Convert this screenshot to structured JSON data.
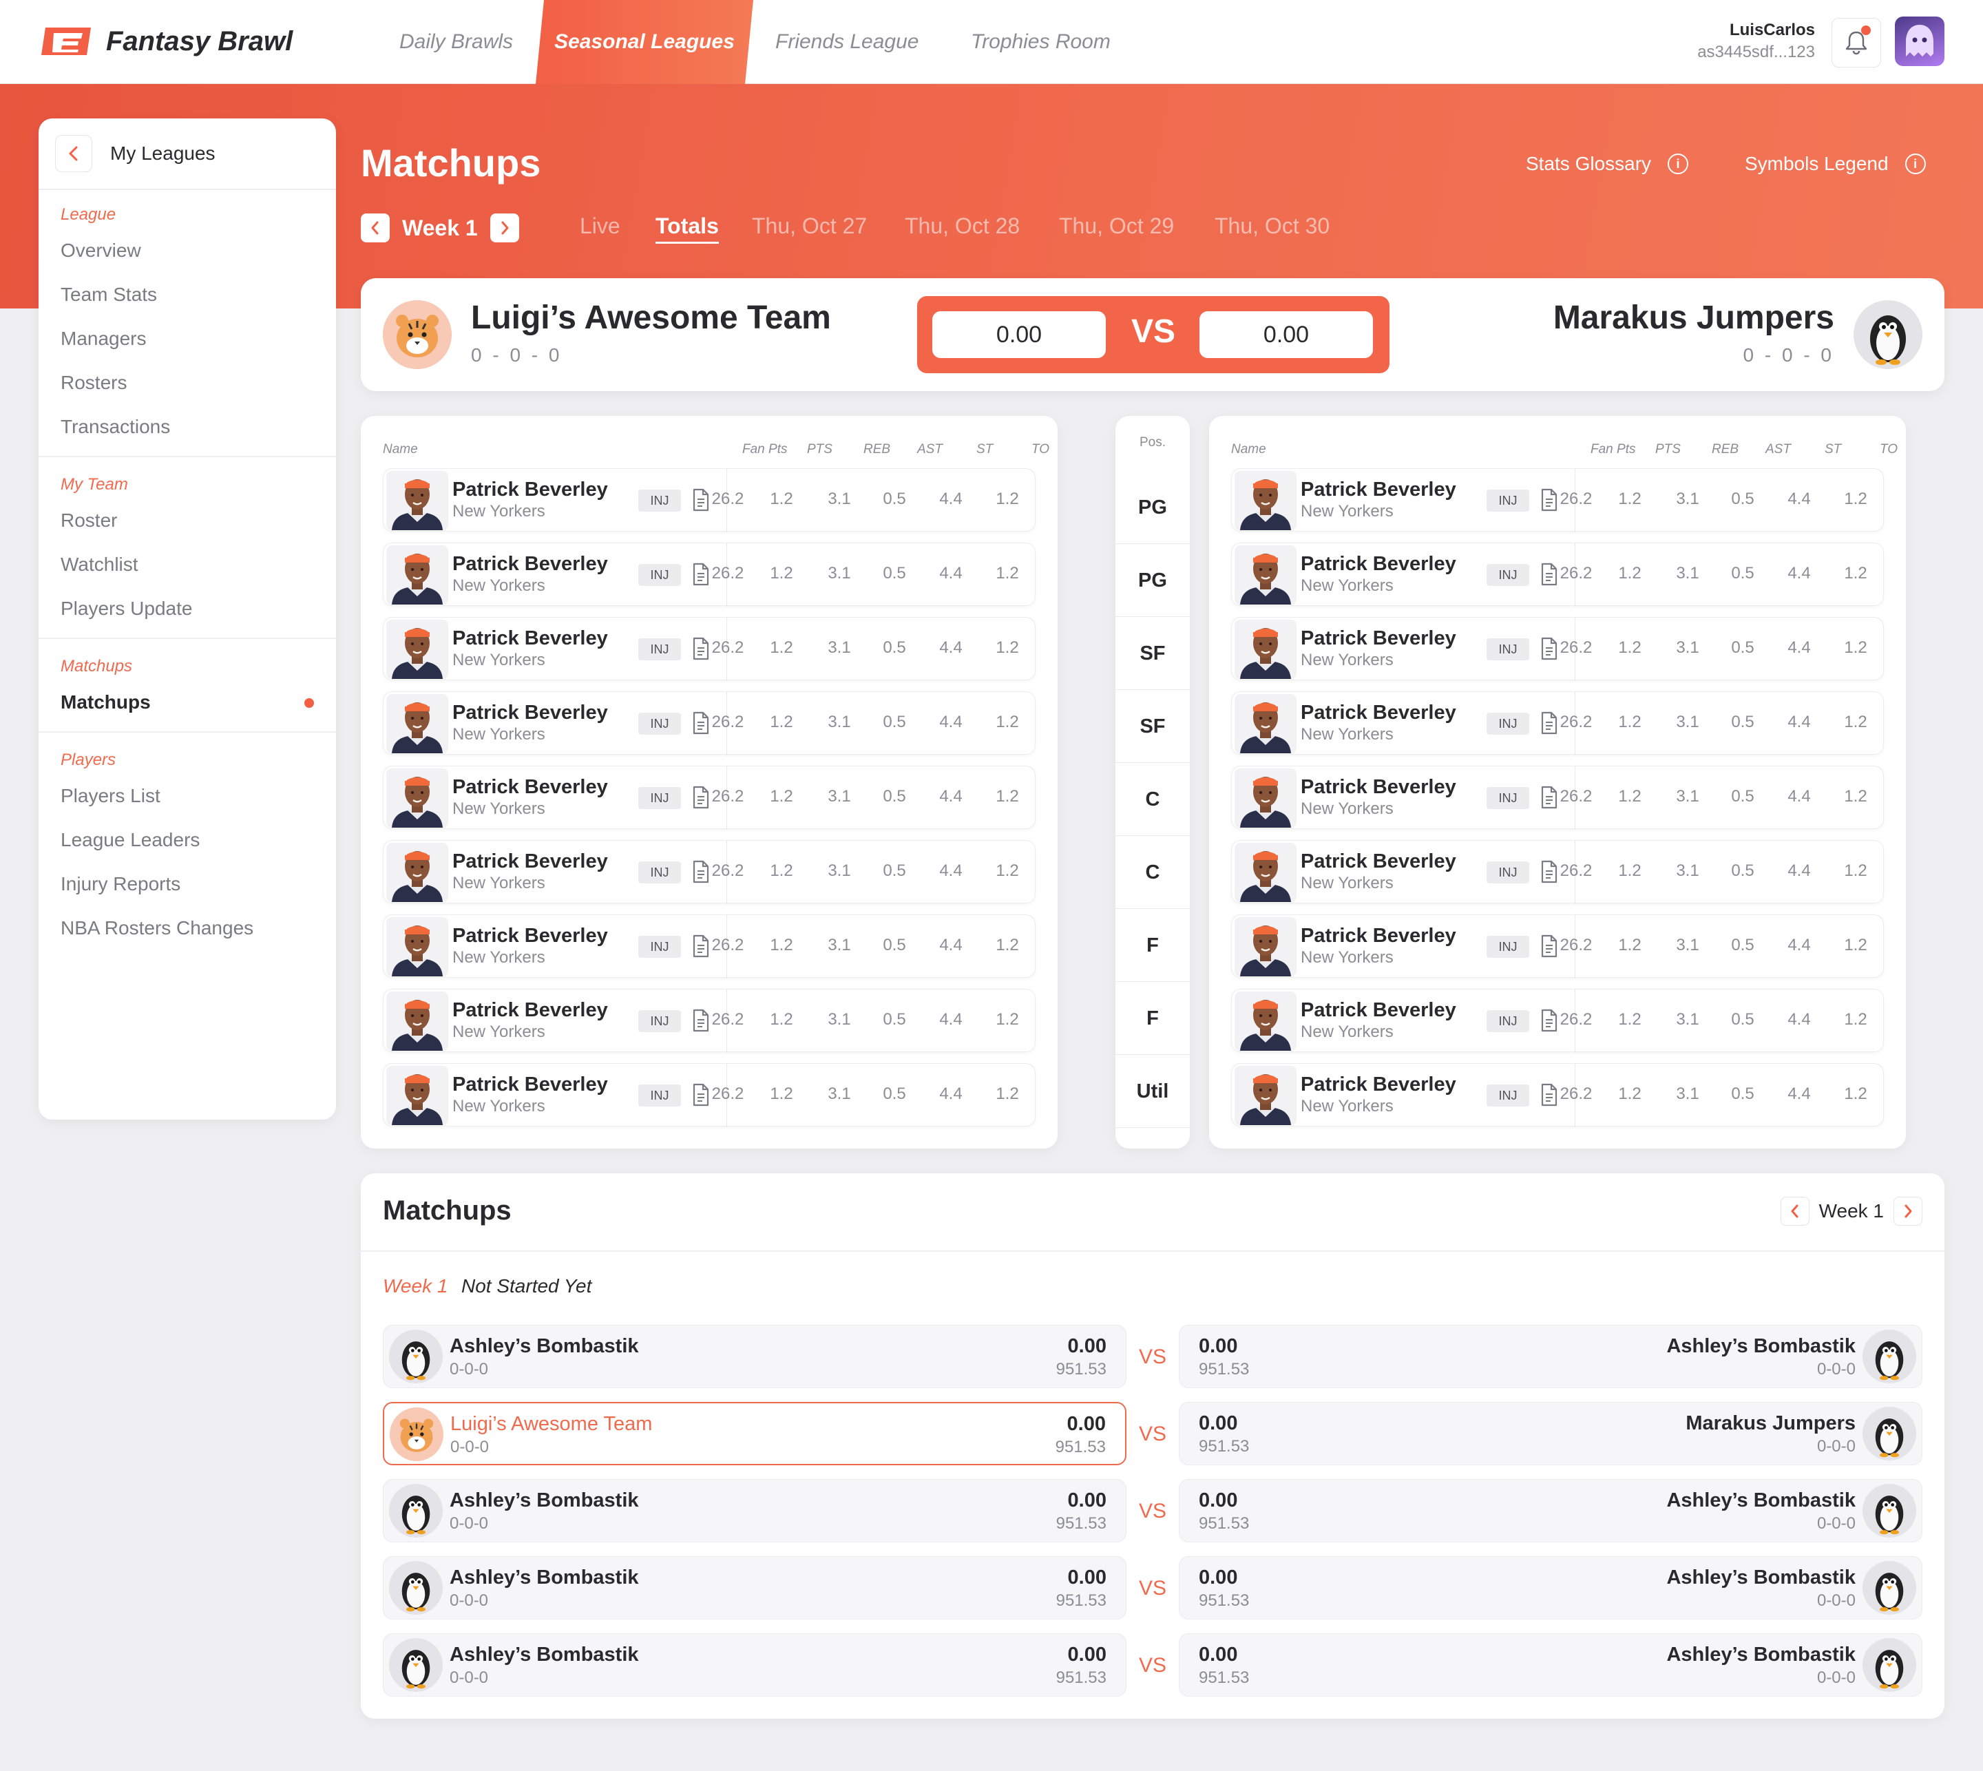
{
  "app": {
    "name": "Fantasy Brawl",
    "nav": [
      "Daily Brawls",
      "Seasonal Leagues",
      "Friends League",
      "Trophies Room"
    ],
    "active_nav": 1,
    "user_name": "LuisCarlos",
    "user_id": "as3445sdf...123",
    "brand_color": "#f25f45"
  },
  "sidebar": {
    "title": "My Leagues",
    "sections": [
      {
        "label": "League",
        "items": [
          "Overview",
          "Team Stats",
          "Managers",
          "Rosters",
          "Transactions"
        ]
      },
      {
        "label": "My Team",
        "items": [
          "Roster",
          "Watchlist",
          "Players Update"
        ]
      },
      {
        "label": "Matchups",
        "items": [
          "Matchups"
        ]
      },
      {
        "label": "Players",
        "items": [
          "Players List",
          "League Leaders",
          "Injury Reports",
          "NBA Rosters Changes"
        ]
      }
    ],
    "active_item": "Matchups"
  },
  "header": {
    "title": "Matchups",
    "stats_glossary": "Stats Glossary",
    "symbols_legend": "Symbols Legend",
    "week": "Week 1",
    "tabs": [
      "Live",
      "Totals",
      "Thu, Oct 27",
      "Thu, Oct 28",
      "Thu, Oct 29",
      "Thu, Oct 30"
    ],
    "active_tab": 1
  },
  "versus": {
    "home": {
      "name": "Luigi’s Awesome Team",
      "record": "0 - 0 - 0",
      "score": "0.00",
      "avatar": "tiger-icon"
    },
    "away": {
      "name": "Marakus Jumpers",
      "record": "0 - 0 - 0",
      "score": "0.00",
      "avatar": "penguin-icon"
    },
    "vs": "VS"
  },
  "roster": {
    "columns": [
      "Name",
      "Fan Pts",
      "PTS",
      "REB",
      "AST",
      "ST",
      "TO"
    ],
    "pos_header": "Pos.",
    "positions": [
      "PG",
      "PG",
      "SF",
      "SF",
      "C",
      "C",
      "F",
      "F",
      "Util"
    ],
    "badge": "INJ",
    "left": [
      {
        "name": "Patrick Beverley",
        "team": "New Yorkers",
        "stats": [
          "26.2",
          "1.2",
          "3.1",
          "0.5",
          "4.4",
          "1.2"
        ]
      },
      {
        "name": "Patrick Beverley",
        "team": "New Yorkers",
        "stats": [
          "26.2",
          "1.2",
          "3.1",
          "0.5",
          "4.4",
          "1.2"
        ]
      },
      {
        "name": "Patrick Beverley",
        "team": "New Yorkers",
        "stats": [
          "26.2",
          "1.2",
          "3.1",
          "0.5",
          "4.4",
          "1.2"
        ]
      },
      {
        "name": "Patrick Beverley",
        "team": "New Yorkers",
        "stats": [
          "26.2",
          "1.2",
          "3.1",
          "0.5",
          "4.4",
          "1.2"
        ]
      },
      {
        "name": "Patrick Beverley",
        "team": "New Yorkers",
        "stats": [
          "26.2",
          "1.2",
          "3.1",
          "0.5",
          "4.4",
          "1.2"
        ]
      },
      {
        "name": "Patrick Beverley",
        "team": "New Yorkers",
        "stats": [
          "26.2",
          "1.2",
          "3.1",
          "0.5",
          "4.4",
          "1.2"
        ]
      },
      {
        "name": "Patrick Beverley",
        "team": "New Yorkers",
        "stats": [
          "26.2",
          "1.2",
          "3.1",
          "0.5",
          "4.4",
          "1.2"
        ]
      },
      {
        "name": "Patrick Beverley",
        "team": "New Yorkers",
        "stats": [
          "26.2",
          "1.2",
          "3.1",
          "0.5",
          "4.4",
          "1.2"
        ]
      },
      {
        "name": "Patrick Beverley",
        "team": "New Yorkers",
        "stats": [
          "26.2",
          "1.2",
          "3.1",
          "0.5",
          "4.4",
          "1.2"
        ]
      }
    ],
    "right": [
      {
        "name": "Patrick Beverley",
        "team": "New Yorkers",
        "stats": [
          "26.2",
          "1.2",
          "3.1",
          "0.5",
          "4.4",
          "1.2"
        ]
      },
      {
        "name": "Patrick Beverley",
        "team": "New Yorkers",
        "stats": [
          "26.2",
          "1.2",
          "3.1",
          "0.5",
          "4.4",
          "1.2"
        ]
      },
      {
        "name": "Patrick Beverley",
        "team": "New Yorkers",
        "stats": [
          "26.2",
          "1.2",
          "3.1",
          "0.5",
          "4.4",
          "1.2"
        ]
      },
      {
        "name": "Patrick Beverley",
        "team": "New Yorkers",
        "stats": [
          "26.2",
          "1.2",
          "3.1",
          "0.5",
          "4.4",
          "1.2"
        ]
      },
      {
        "name": "Patrick Beverley",
        "team": "New Yorkers",
        "stats": [
          "26.2",
          "1.2",
          "3.1",
          "0.5",
          "4.4",
          "1.2"
        ]
      },
      {
        "name": "Patrick Beverley",
        "team": "New Yorkers",
        "stats": [
          "26.2",
          "1.2",
          "3.1",
          "0.5",
          "4.4",
          "1.2"
        ]
      },
      {
        "name": "Patrick Beverley",
        "team": "New Yorkers",
        "stats": [
          "26.2",
          "1.2",
          "3.1",
          "0.5",
          "4.4",
          "1.2"
        ]
      },
      {
        "name": "Patrick Beverley",
        "team": "New Yorkers",
        "stats": [
          "26.2",
          "1.2",
          "3.1",
          "0.5",
          "4.4",
          "1.2"
        ]
      },
      {
        "name": "Patrick Beverley",
        "team": "New Yorkers",
        "stats": [
          "26.2",
          "1.2",
          "3.1",
          "0.5",
          "4.4",
          "1.2"
        ]
      }
    ]
  },
  "matchups": {
    "title": "Matchups",
    "week": "Week 1",
    "status_week": "Week 1",
    "status": "Not Started Yet",
    "vs": "VS",
    "games": [
      {
        "home": {
          "name": "Ashley’s Bombastik",
          "record": "0-0-0",
          "score": "0.00",
          "proj": "951.53",
          "avatar": "penguin-icon"
        },
        "away": {
          "name": "Ashley’s Bombastik",
          "record": "0-0-0",
          "score": "0.00",
          "proj": "951.53",
          "avatar": "penguin-icon"
        },
        "highlight": false
      },
      {
        "home": {
          "name": "Luigi’s Awesome Team",
          "record": "0-0-0",
          "score": "0.00",
          "proj": "951.53",
          "avatar": "tiger-icon"
        },
        "away": {
          "name": "Marakus Jumpers",
          "record": "0-0-0",
          "score": "0.00",
          "proj": "951.53",
          "avatar": "penguin-icon"
        },
        "highlight": true
      },
      {
        "home": {
          "name": "Ashley’s Bombastik",
          "record": "0-0-0",
          "score": "0.00",
          "proj": "951.53",
          "avatar": "penguin-icon"
        },
        "away": {
          "name": "Ashley’s Bombastik",
          "record": "0-0-0",
          "score": "0.00",
          "proj": "951.53",
          "avatar": "penguin-icon"
        },
        "highlight": false
      },
      {
        "home": {
          "name": "Ashley’s Bombastik",
          "record": "0-0-0",
          "score": "0.00",
          "proj": "951.53",
          "avatar": "penguin-icon"
        },
        "away": {
          "name": "Ashley’s Bombastik",
          "record": "0-0-0",
          "score": "0.00",
          "proj": "951.53",
          "avatar": "penguin-icon"
        },
        "highlight": false
      },
      {
        "home": {
          "name": "Ashley’s Bombastik",
          "record": "0-0-0",
          "score": "0.00",
          "proj": "951.53",
          "avatar": "penguin-icon"
        },
        "away": {
          "name": "Ashley’s Bombastik",
          "record": "0-0-0",
          "score": "0.00",
          "proj": "951.53",
          "avatar": "penguin-icon"
        },
        "highlight": false
      }
    ]
  }
}
